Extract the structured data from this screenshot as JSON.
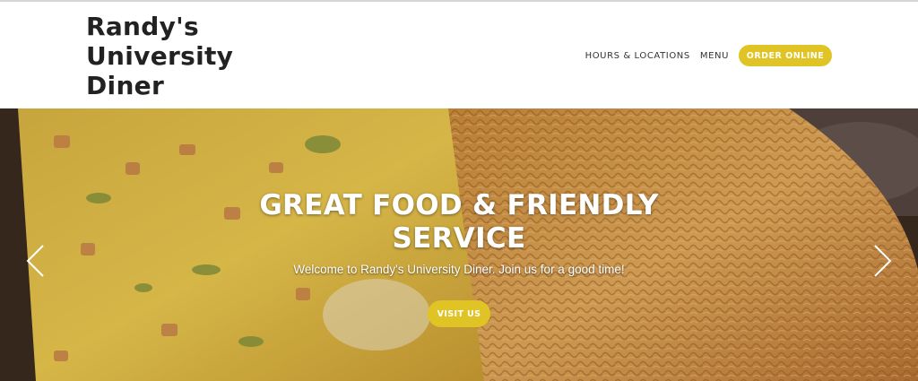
{
  "brand": {
    "lines": [
      "Randy's",
      "University",
      "Diner"
    ]
  },
  "nav": {
    "hours_label": "HOURS & LOCATIONS",
    "menu_label": "MENU",
    "order_label": "ORDER ONLINE"
  },
  "hero": {
    "title": "GREAT FOOD & FRIENDLY SERVICE",
    "subtitle": "Welcome to Randy's University Diner. Join us for a good time!",
    "cta_label": "VISIT US",
    "prev_icon": "chevron-left-icon",
    "next_icon": "chevron-right-icon"
  },
  "colors": {
    "accent": "#e0c426",
    "text_dark": "#222222",
    "hero_text": "#ffffff"
  }
}
